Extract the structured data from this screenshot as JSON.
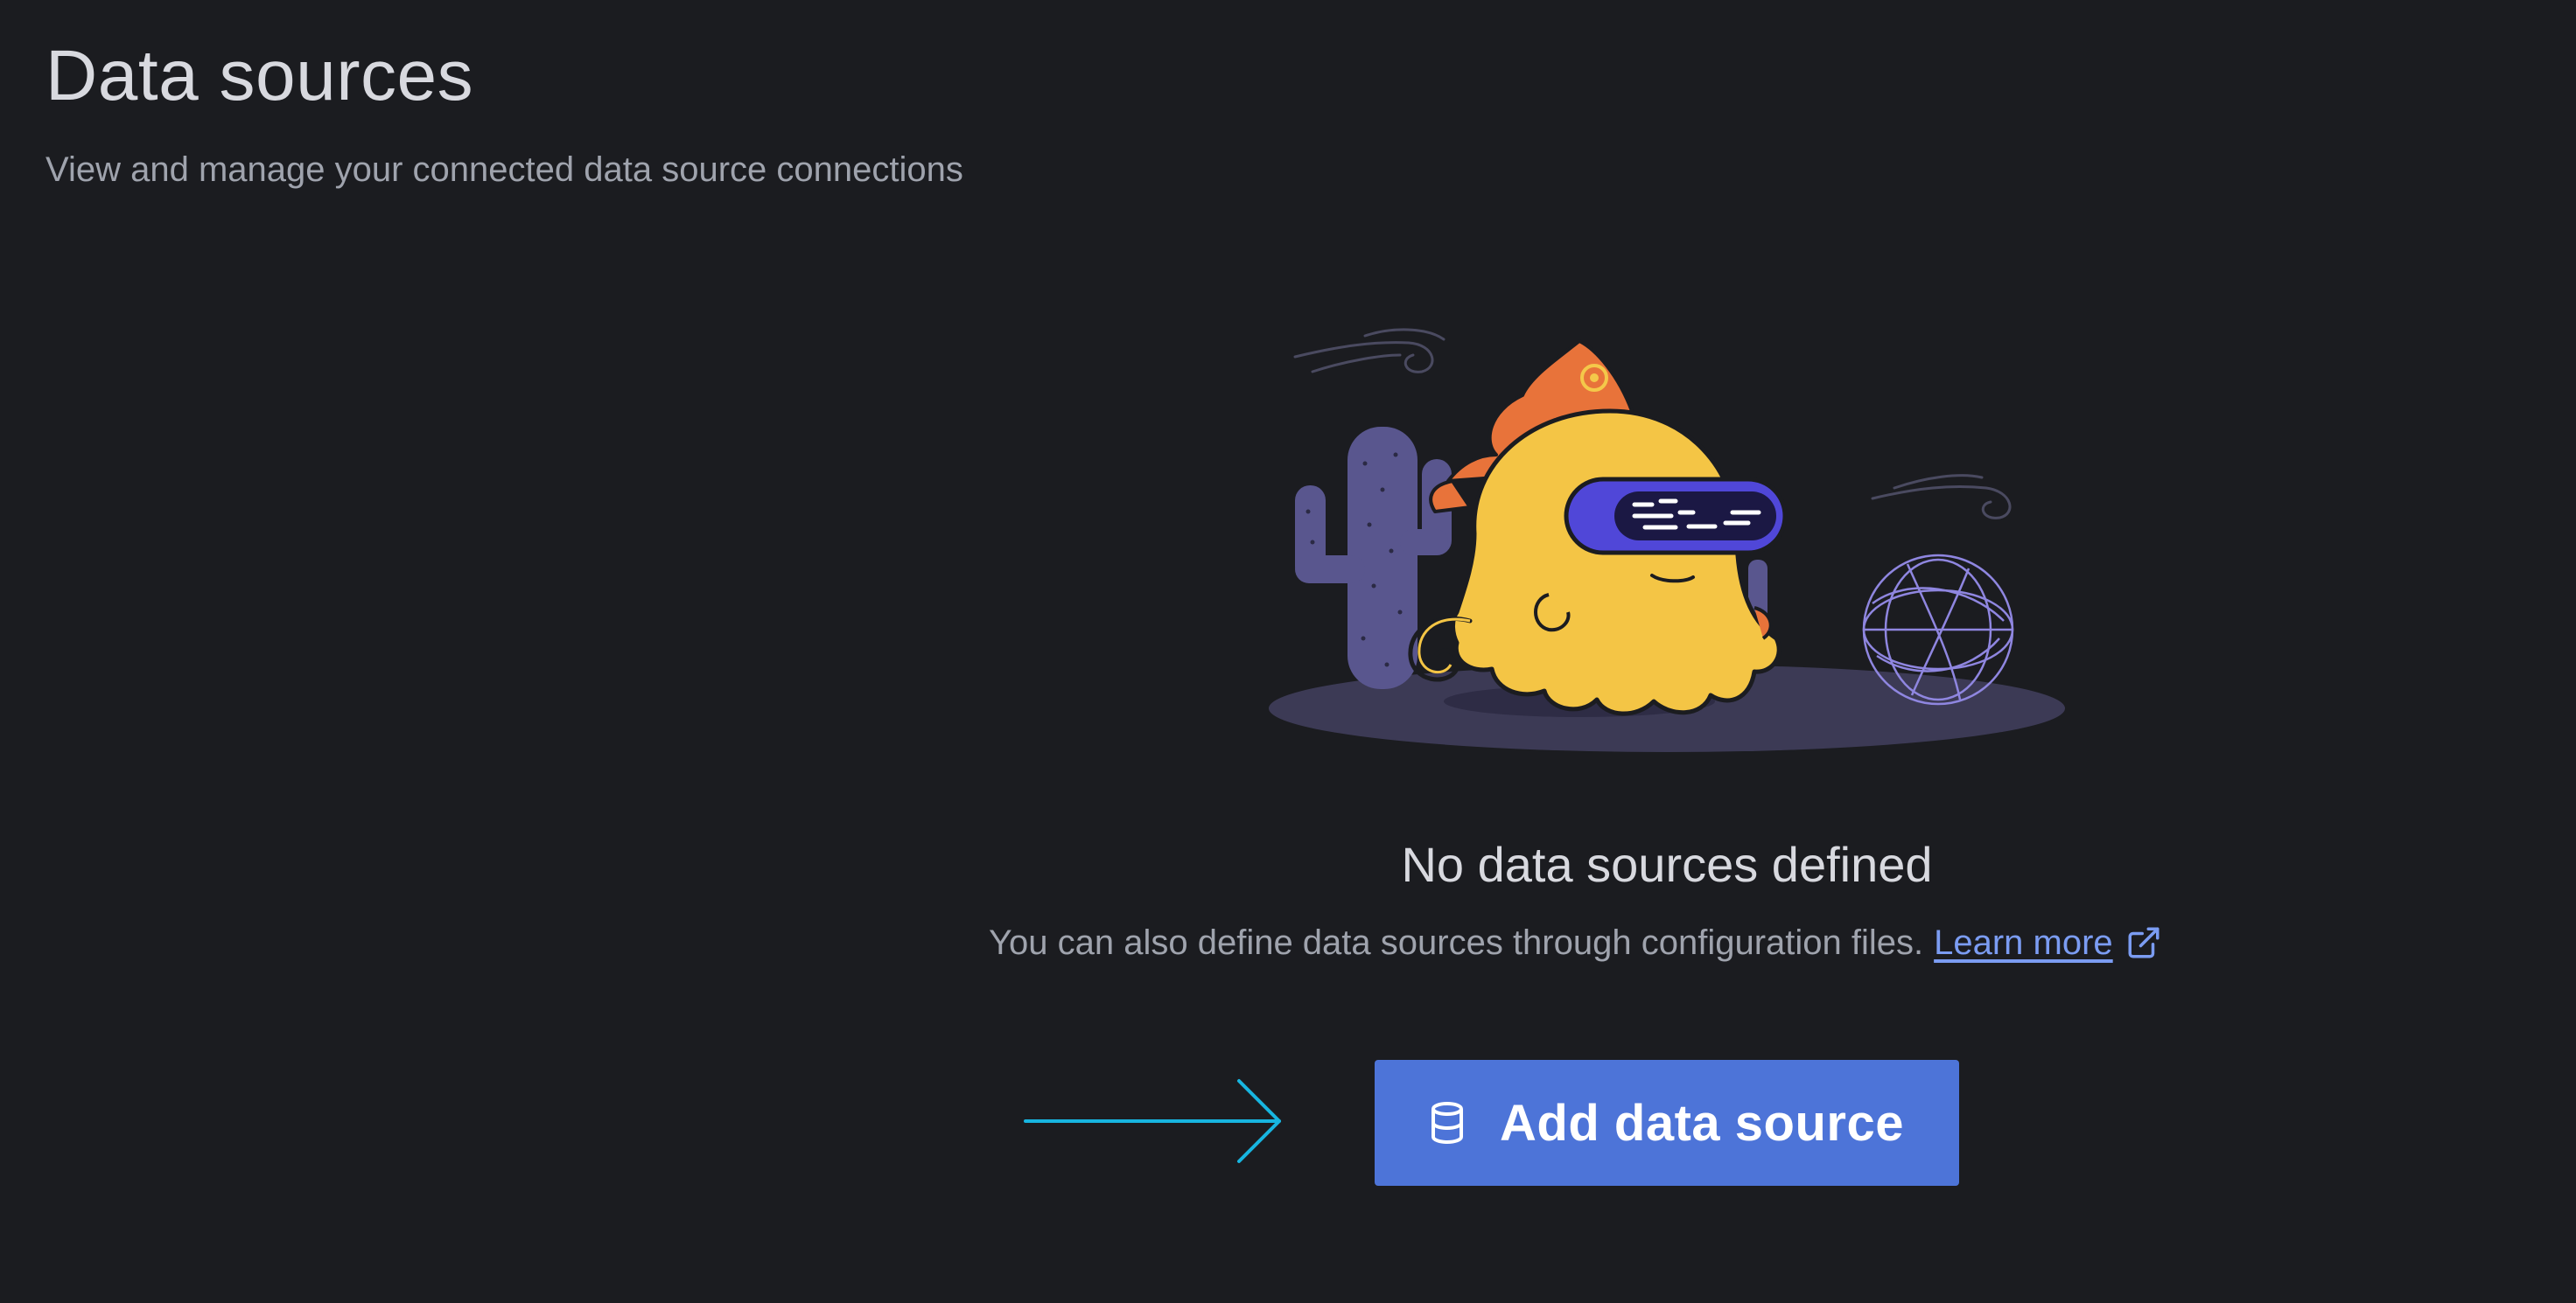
{
  "header": {
    "title": "Data sources",
    "subtitle": "View and manage your connected data source connections"
  },
  "empty_state": {
    "title": "No data sources defined",
    "description": "You can also define data sources through configuration files.",
    "learn_more_label": "Learn more",
    "illustration": "grafana-mascot-desert-empty-state",
    "external_icon": "external-link-icon"
  },
  "actions": {
    "add_button_label": "Add data source",
    "add_button_icon": "database-icon",
    "pointer": "arrow-right-annotation"
  },
  "colors": {
    "background": "#1b1c20",
    "primary_button": "#4d74d8",
    "link": "#7b9cf2",
    "annotation_arrow": "#17b5e0"
  }
}
